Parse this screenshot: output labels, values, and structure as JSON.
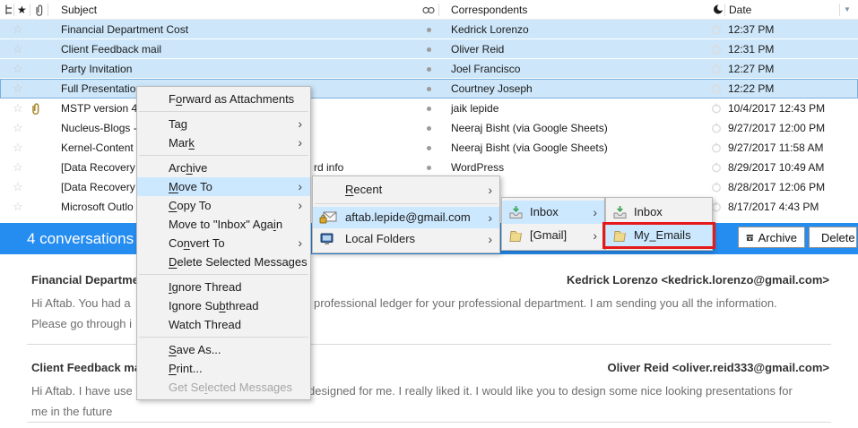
{
  "list_header": {
    "subject": "Subject",
    "correspondents": "Correspondents",
    "date": "Date"
  },
  "icons": {
    "star_outline": "☆",
    "star_filled": "★",
    "sort_desc": "▼",
    "submenu_arrow": "›"
  },
  "colors": {
    "selection_blue": "#cde6f9",
    "menu_highlight": "#cce8ff",
    "conversation_bar_blue": "#258cf0",
    "annotation_red": "#e41a1a"
  },
  "mail_list": {
    "rows": [
      {
        "subject": "Financial Department Cost",
        "correspondent": "Kedrick Lorenzo",
        "date": "12:37 PM"
      },
      {
        "subject": "Client Feedback mail",
        "correspondent": "Oliver Reid",
        "date": "12:31 PM"
      },
      {
        "subject": "Party Invitation",
        "correspondent": "Joel Francisco",
        "date": "12:27 PM"
      },
      {
        "subject": "Full Presentation",
        "correspondent": "Courtney Joseph",
        "date": "12:22 PM"
      },
      {
        "subject": "MSTP version 4",
        "correspondent": "jaik lepide",
        "date": "10/4/2017 12:43 PM"
      },
      {
        "subject": "Nucleus-Blogs -",
        "correspondent": "Neeraj Bisht (via Google Sheets)",
        "date": "9/27/2017 12:00 PM"
      },
      {
        "subject": "Kernel-Content",
        "correspondent": "Neeraj Bisht (via Google Sheets)",
        "date": "9/27/2017 11:58 AM"
      },
      {
        "subject": "[Data Recovery",
        "subject_tail": "rd info",
        "correspondent": "WordPress",
        "date": "8/29/2017 10:49 AM"
      },
      {
        "subject": "[Data Recovery",
        "correspondent": "",
        "date": "8/28/2017 12:06 PM"
      },
      {
        "subject": "Microsoft Outlo",
        "correspondent": "",
        "date": "8/17/2017 4:43 PM"
      }
    ]
  },
  "context_menu": {
    "items": [
      {
        "label": "Forward as Attachments",
        "mn": 1
      },
      {
        "label": "Tag",
        "mn": 2
      },
      {
        "label": "Mark",
        "mn": 3
      },
      {
        "label": "Archive",
        "mn": 3
      },
      {
        "label": "Move To",
        "mn": 0
      },
      {
        "label": "Copy To",
        "mn": 0
      },
      {
        "label": "Move to \"Inbox\" Again",
        "mn": 19
      },
      {
        "label": "Convert To",
        "mn": 2
      },
      {
        "label": "Delete Selected Messages",
        "mn": 0
      },
      {
        "label": "Ignore Thread",
        "mn": 0
      },
      {
        "label": "Ignore Subthread",
        "mn": 9
      },
      {
        "label": "Watch Thread",
        "mn": -1
      },
      {
        "label": "Save As...",
        "mn": 0
      },
      {
        "label": "Print...",
        "mn": 0
      },
      {
        "label": "Get Selected Messages",
        "mn": 6
      }
    ]
  },
  "submenus": {
    "accounts": {
      "items": [
        {
          "label": "Recent",
          "mn": 0
        },
        {
          "label": "aftab.lepide@gmail.com",
          "mn": -1
        },
        {
          "label": "Local Folders",
          "mn": -1
        }
      ]
    },
    "folders_level1": {
      "items": [
        {
          "label": "Inbox"
        },
        {
          "label": "[Gmail]"
        }
      ]
    },
    "folders_level2": {
      "items": [
        {
          "label": "Inbox"
        },
        {
          "label": "My_Emails"
        }
      ]
    }
  },
  "conversation_bar": {
    "count_label": "4 conversations",
    "archive_label": "Archive",
    "delete_label": "Delete"
  },
  "previews": [
    {
      "title": "Financial Department Cost",
      "sender": "Kedrick Lorenzo <kedrick.lorenzo@gmail.com>",
      "line1_left": "Hi Aftab. You had a",
      "line1_right": "professional ledger for your professional department. I am sending you all the information.",
      "line2": "Please go through i"
    },
    {
      "title": "Client Feedback mail",
      "sender": "Oliver Reid <oliver.reid333@gmail.com>",
      "line1_left": "Hi Aftab. I have use",
      "line1_right": "designed for me. I really liked it. I would like you to design some nice looking presentations for",
      "line2": "me in the future"
    }
  ]
}
